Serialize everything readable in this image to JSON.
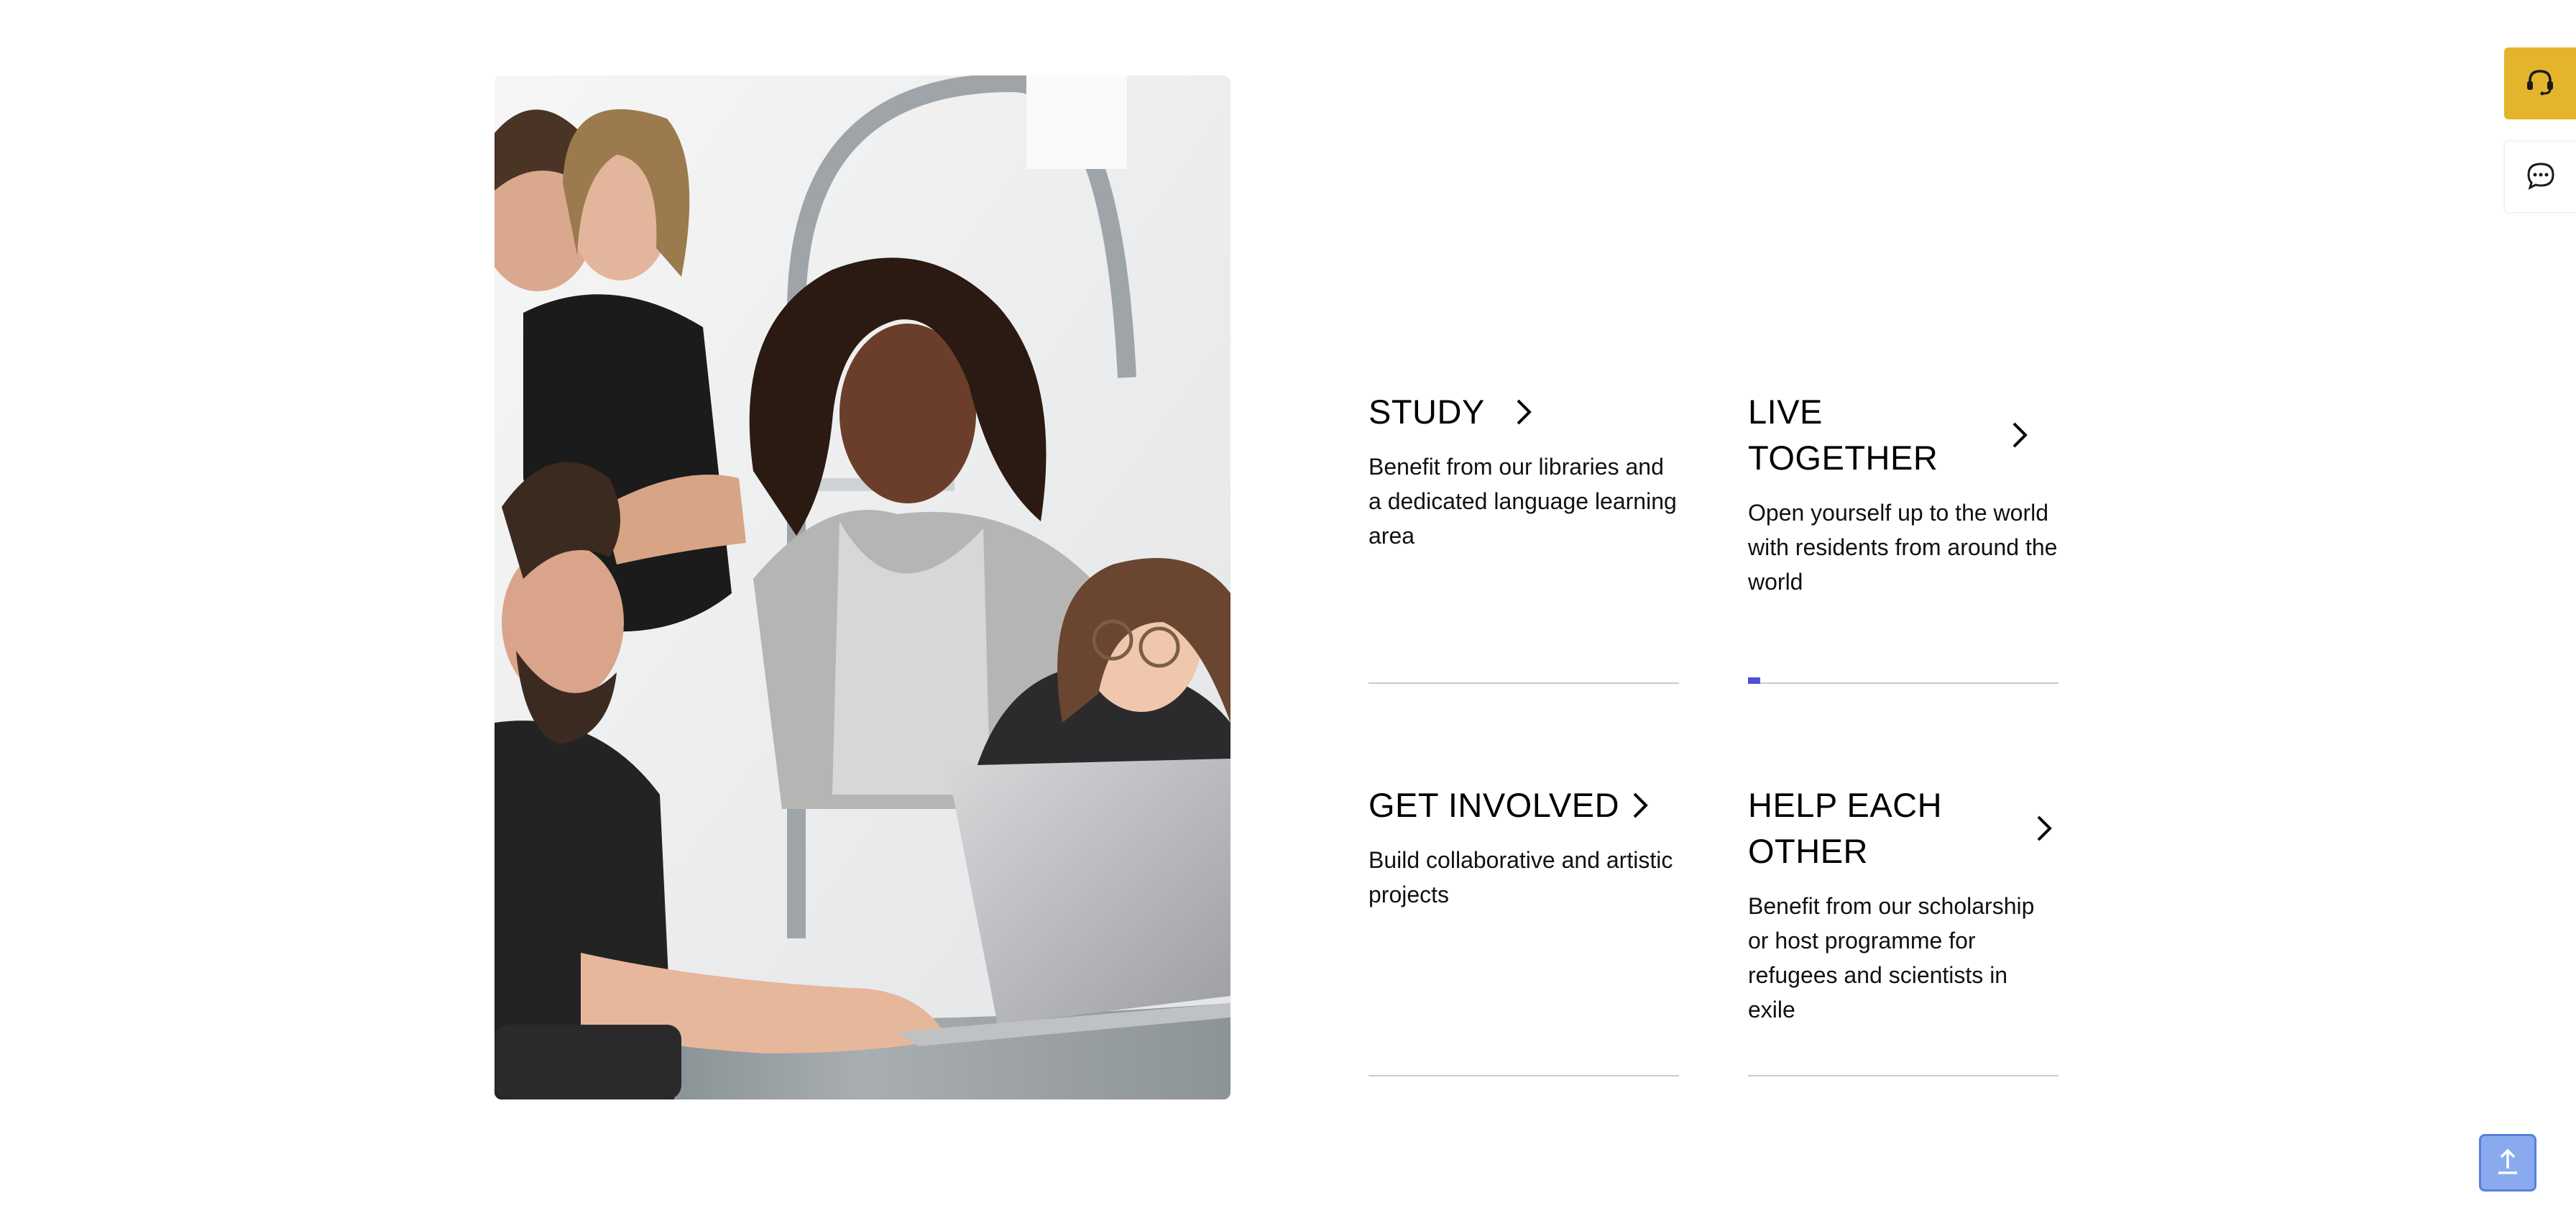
{
  "hero_image": {
    "alt": "Group of young people gathered around a laptop, smiling"
  },
  "cards": [
    {
      "title": "STUDY",
      "text": "Benefit from our libraries and a dedicated language learning area",
      "icon": "chevron-right-icon"
    },
    {
      "title": "LIVE TOGETHER",
      "text": "Open yourself up to the world with residents from around the world",
      "icon": "chevron-right-icon",
      "progress": 0.04
    },
    {
      "title": "GET INVOLVED",
      "text": "Build collaborative and artistic projects",
      "icon": "chevron-right-icon"
    },
    {
      "title": "HELP EACH OTHER",
      "text": "Benefit from our scholarship or host programme for refugees and scientists in exile",
      "icon": "chevron-right-icon"
    }
  ],
  "side_buttons": {
    "help": {
      "icon": "headset-icon"
    },
    "chat": {
      "icon": "chat-bubble-icon"
    }
  },
  "back_to_top": {
    "icon": "arrow-up-icon"
  },
  "colors": {
    "accent": "#4f4fd8",
    "help_button": "#e4b42c",
    "back_to_top": "#8aaaf0",
    "divider": "#c9c9c9"
  }
}
